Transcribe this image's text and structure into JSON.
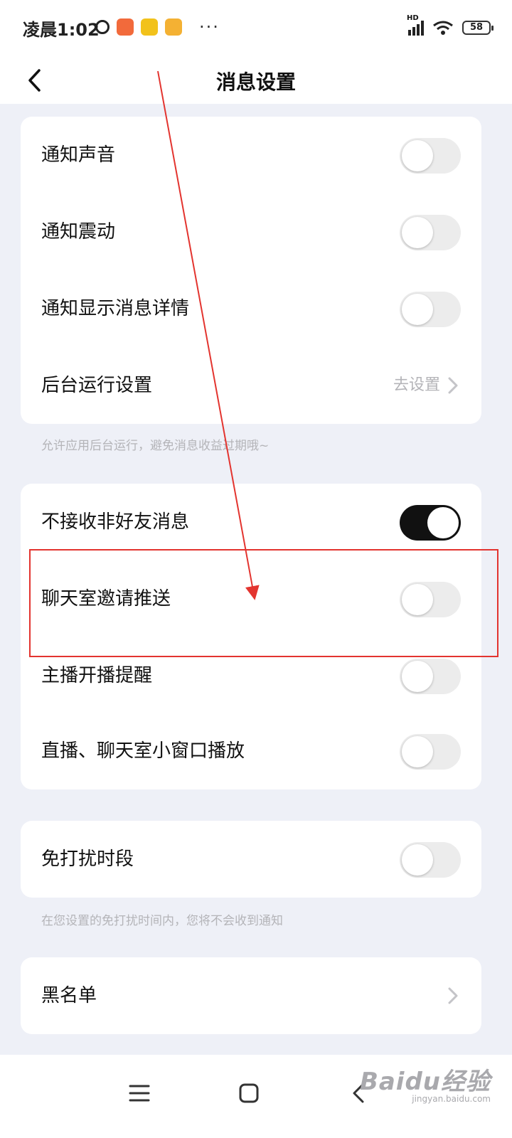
{
  "status_bar": {
    "time": "凌晨1:02",
    "battery": "58",
    "network": "HD",
    "colors": {
      "app1": "#f26a3b",
      "app2": "#f2c21b",
      "app3": "#f4b133"
    }
  },
  "nav": {
    "title": "消息设置"
  },
  "group1": {
    "items": [
      {
        "label": "通知声音",
        "on": false
      },
      {
        "label": "通知震动",
        "on": false
      },
      {
        "label": "通知显示消息详情",
        "on": false
      }
    ],
    "background_run": {
      "label": "后台运行设置",
      "value": "去设置"
    },
    "hint": "允许应用后台运行，避免消息收益过期哦~"
  },
  "group2": {
    "items": [
      {
        "label": "不接收非好友消息",
        "on": true
      },
      {
        "label": "聊天室邀请推送",
        "on": false
      },
      {
        "label": "主播开播提醒",
        "on": false
      },
      {
        "label": "直播、聊天室小窗口播放",
        "on": false
      }
    ]
  },
  "group3": {
    "item": {
      "label": "免打扰时段",
      "on": false
    },
    "hint": "在您设置的免打扰时间内，您将不会收到通知"
  },
  "group4": {
    "blacklist_label": "黑名单"
  },
  "watermark": {
    "logo": "Baidu经验",
    "sub": "jingyan.baidu.com"
  },
  "colors": {
    "annotation": "#e3342f",
    "toggle_on": "#111111",
    "toggle_off": "#ececec"
  }
}
